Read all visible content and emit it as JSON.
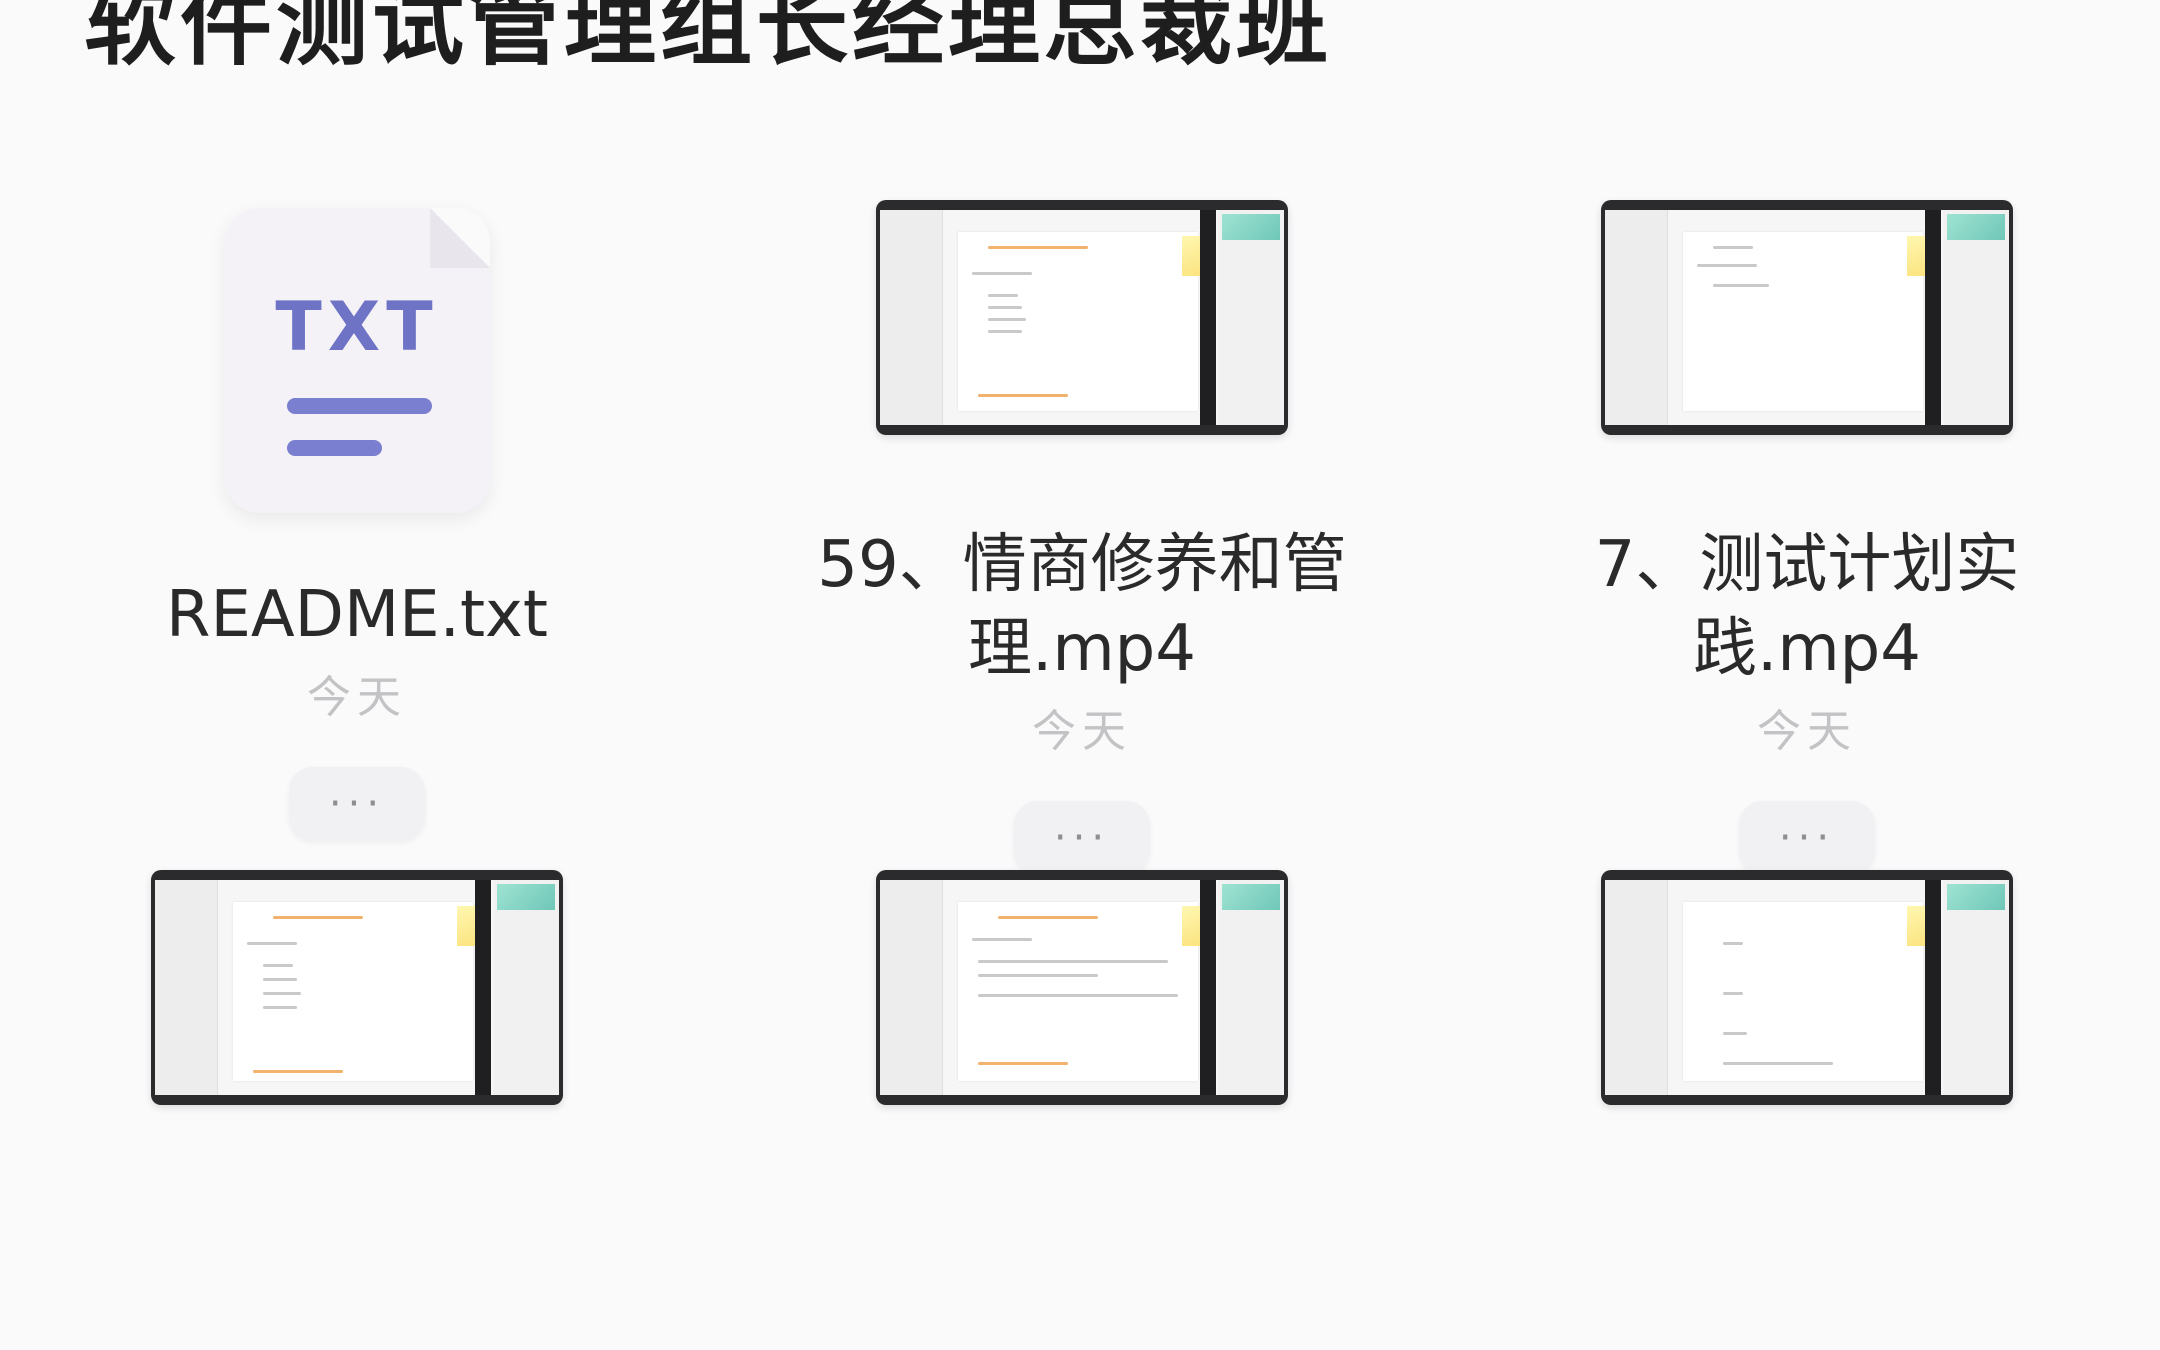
{
  "folder": {
    "title": "软件测试管理组长经理总裁班"
  },
  "files": [
    {
      "kind": "txt",
      "icon": "txt-file-icon",
      "icon_text": "TXT",
      "name": "README.txt",
      "date": "今天",
      "more_label": "···"
    },
    {
      "kind": "video",
      "icon": "video-thumbnail",
      "name": "59、情商修养和管理.mp4",
      "date": "今天",
      "more_label": "···"
    },
    {
      "kind": "video",
      "icon": "video-thumbnail",
      "name": "7、测试计划实践.mp4",
      "date": "今天",
      "more_label": "···"
    },
    {
      "kind": "video",
      "icon": "video-thumbnail"
    },
    {
      "kind": "video",
      "icon": "video-thumbnail"
    },
    {
      "kind": "video",
      "icon": "video-thumbnail"
    }
  ],
  "colors": {
    "background": "#fafafb",
    "title_text": "#1e1e1e",
    "txt_accent": "#6e73c6",
    "date_text": "#c3c3c6"
  }
}
